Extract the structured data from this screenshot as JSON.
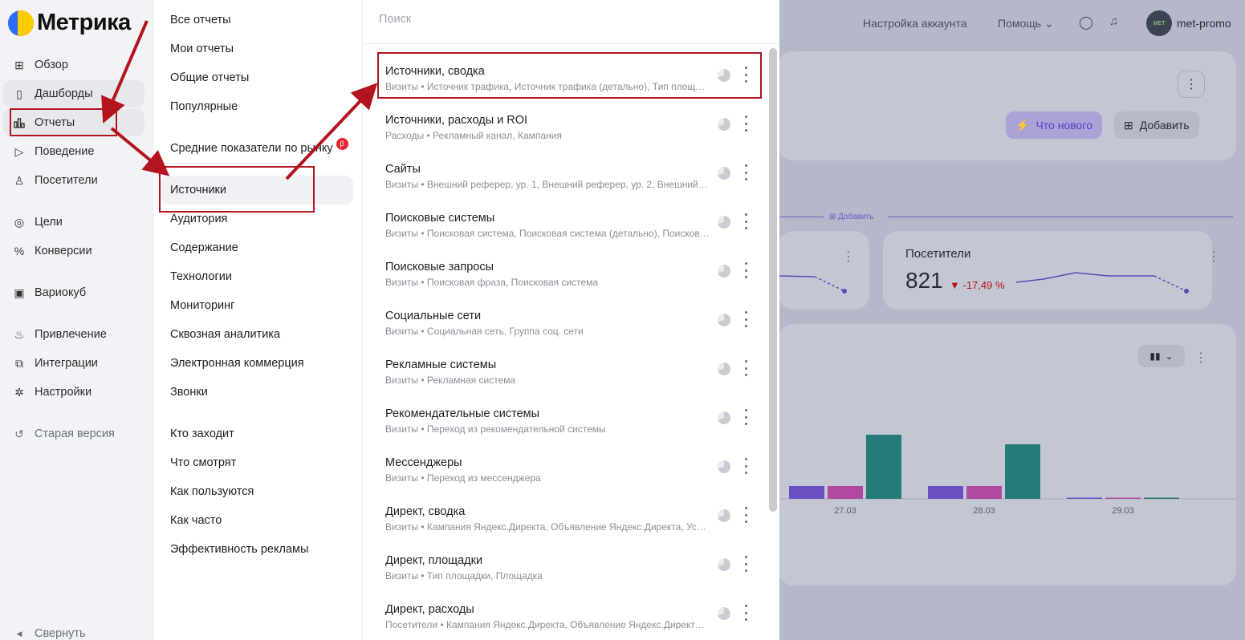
{
  "brand": {
    "name": "Метрика"
  },
  "sidebar": {
    "items": [
      {
        "label": "Обзор",
        "icon": "grid-icon"
      },
      {
        "label": "Дашборды",
        "icon": "dashboard-icon"
      },
      {
        "label": "Отчеты",
        "icon": "bar-chart-icon"
      },
      {
        "label": "Поведение",
        "icon": "play-icon"
      },
      {
        "label": "Посетители",
        "icon": "user-icon"
      },
      {
        "label": "Цели",
        "icon": "target-icon"
      },
      {
        "label": "Конверсии",
        "icon": "percent-icon"
      },
      {
        "label": "Вариокуб",
        "icon": "cube-icon"
      },
      {
        "label": "Привлечение",
        "icon": "fire-icon"
      },
      {
        "label": "Интеграции",
        "icon": "puzzle-icon"
      },
      {
        "label": "Настройки",
        "icon": "gear-icon"
      },
      {
        "label": "Старая версия",
        "icon": "undo-icon"
      }
    ],
    "collapse_label": "Свернуть"
  },
  "categories": {
    "items": [
      {
        "label": "Все отчеты"
      },
      {
        "label": "Мои отчеты"
      },
      {
        "label": "Общие отчеты"
      },
      {
        "label": "Популярные"
      },
      {
        "label": "Средние показатели по рынку",
        "badge": "β"
      },
      {
        "label": "Источники"
      },
      {
        "label": "Аудитория"
      },
      {
        "label": "Содержание"
      },
      {
        "label": "Технологии"
      },
      {
        "label": "Мониторинг"
      },
      {
        "label": "Сквозная аналитика"
      },
      {
        "label": "Электронная коммерция"
      },
      {
        "label": "Звонки"
      },
      {
        "label": "Кто заходит"
      },
      {
        "label": "Что смотрят"
      },
      {
        "label": "Как пользуются"
      },
      {
        "label": "Как часто"
      },
      {
        "label": "Эффективность рекламы"
      }
    ]
  },
  "reports": {
    "search_placeholder": "Поиск",
    "items": [
      {
        "title": "Источники, сводка",
        "sub": "Визиты • Источник трафика, Источник трафика (детально), Тип площа…"
      },
      {
        "title": "Источники, расходы и ROI",
        "sub": "Расходы • Рекламный канал, Кампания"
      },
      {
        "title": "Сайты",
        "sub": "Визиты • Внешний реферер, ур. 1, Внешний реферер, ур. 2, Внешний р…"
      },
      {
        "title": "Поисковые системы",
        "sub": "Визиты • Поисковая система, Поисковая система (детально), Поисков…"
      },
      {
        "title": "Поисковые запросы",
        "sub": "Визиты • Поисковая фраза, Поисковая система"
      },
      {
        "title": "Социальные сети",
        "sub": "Визиты • Социальная сеть, Группа соц. сети"
      },
      {
        "title": "Рекламные системы",
        "sub": "Визиты • Рекламная система"
      },
      {
        "title": "Рекомендательные системы",
        "sub": "Визиты • Переход из рекомендательной системы"
      },
      {
        "title": "Мессенджеры",
        "sub": "Визиты • Переход из мессенджера"
      },
      {
        "title": "Директ, сводка",
        "sub": "Визиты • Кампания Яндекс.Директа, Объявление Яндекс.Директа, Усл…"
      },
      {
        "title": "Директ, площадки",
        "sub": "Визиты • Тип площадки, Площадка"
      },
      {
        "title": "Директ, расходы",
        "sub": "Посетители • Кампания Яндекс.Директа, Объявление Яндекс.Директа…"
      }
    ]
  },
  "header": {
    "account_settings": "Настройка аккаунта",
    "help": "Помощь",
    "user": "met-promo",
    "avatar_text": "MET"
  },
  "dashboard": {
    "whats_new": "Что нового",
    "add": "Добавить",
    "add_small": "Добавить",
    "visitors_label": "Посетители",
    "visitors_value": "821",
    "visitors_delta": "-17,49 %"
  },
  "chart_data": {
    "type": "bar",
    "categories": [
      "27.03",
      "28.03",
      "29.03"
    ],
    "series": [
      {
        "values": [
          4,
          4,
          0.2
        ]
      },
      {
        "values": [
          4,
          4,
          0.2
        ]
      },
      {
        "values": [
          20,
          17,
          0.2
        ]
      }
    ],
    "colors": [
      "#6a4fc2",
      "#b04aa0",
      "#257a7a"
    ]
  },
  "colors": {
    "accent_red": "#b3141d",
    "dim": "#b4b8c8"
  }
}
